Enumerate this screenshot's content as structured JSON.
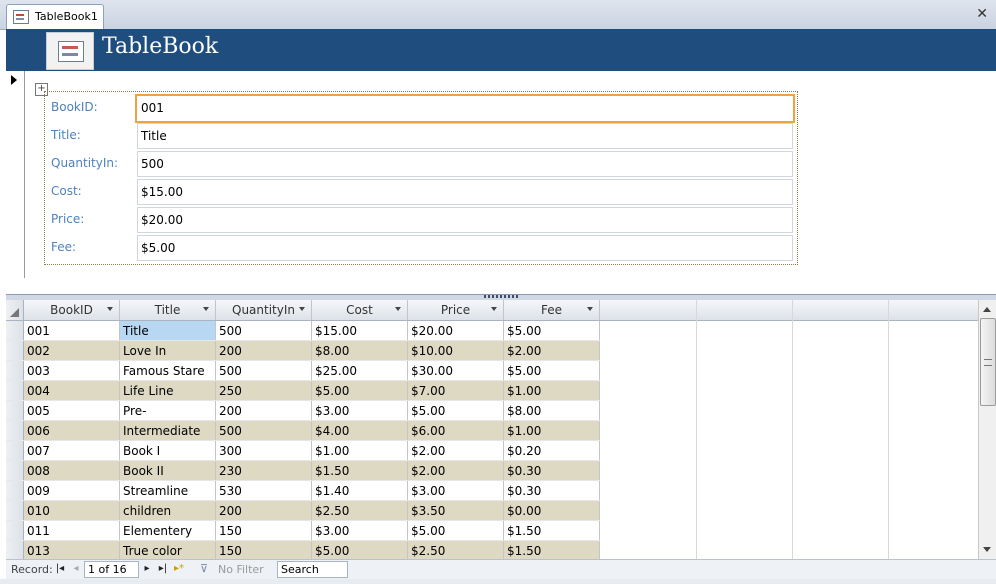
{
  "tab": {
    "label": "TableBook1"
  },
  "header": {
    "title": "TableBook"
  },
  "form": {
    "fields": [
      {
        "label": "BookID:",
        "value": "001"
      },
      {
        "label": "Title:",
        "value": "Title"
      },
      {
        "label": "QuantityIn:",
        "value": "500"
      },
      {
        "label": "Cost:",
        "value": "$15.00"
      },
      {
        "label": "Price:",
        "value": "$20.00"
      },
      {
        "label": "Fee:",
        "value": "$5.00"
      }
    ]
  },
  "datasheet": {
    "columns": [
      "BookID",
      "Title",
      "QuantityIn",
      "Cost",
      "Price",
      "Fee"
    ],
    "rows": [
      [
        "001",
        "Title",
        "500",
        "$15.00",
        "$20.00",
        "$5.00"
      ],
      [
        "002",
        "Love In",
        "200",
        "$8.00",
        "$10.00",
        "$2.00"
      ],
      [
        "003",
        "Famous Stare",
        "500",
        "$25.00",
        "$30.00",
        "$5.00"
      ],
      [
        "004",
        "Life Line",
        "250",
        "$5.00",
        "$7.00",
        "$1.00"
      ],
      [
        "005",
        "Pre-",
        "200",
        "$3.00",
        "$5.00",
        "$8.00"
      ],
      [
        "006",
        "Intermediate",
        "500",
        "$4.00",
        "$6.00",
        "$1.00"
      ],
      [
        "007",
        "Book I",
        "300",
        "$1.00",
        "$2.00",
        "$0.20"
      ],
      [
        "008",
        "Book II",
        "230",
        "$1.50",
        "$2.00",
        "$0.30"
      ],
      [
        "009",
        "Streamline",
        "530",
        "$1.40",
        "$3.00",
        "$0.30"
      ],
      [
        "010",
        "children",
        "200",
        "$2.50",
        "$3.50",
        "$0.00"
      ],
      [
        "011",
        "Elementery",
        "150",
        "$3.00",
        "$5.00",
        "$1.50"
      ],
      [
        "013",
        "True color",
        "150",
        "$5.00",
        "$2.50",
        "$1.50"
      ]
    ]
  },
  "navbar": {
    "record_label": "Record:",
    "position": "1 of 16",
    "filter_label": "No Filter",
    "search_text": "Search"
  }
}
